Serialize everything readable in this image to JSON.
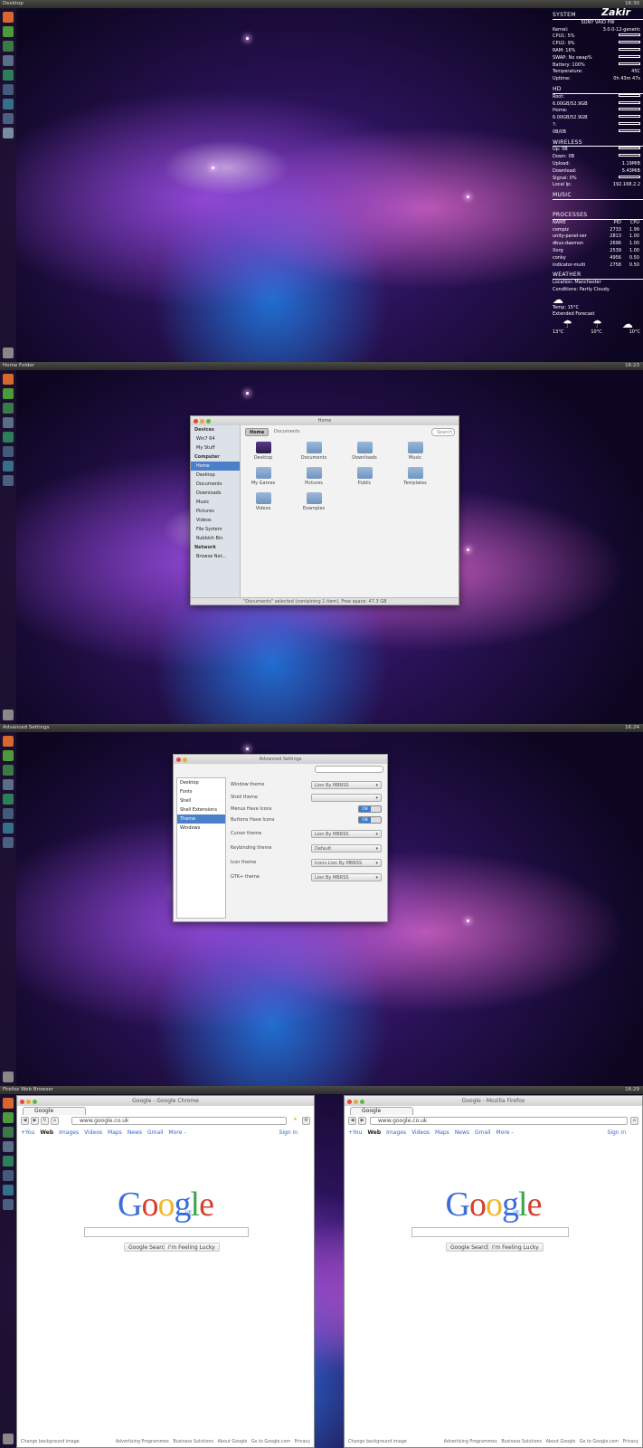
{
  "shots": [
    {
      "title": "Desktop",
      "time": "16:30"
    },
    {
      "title": "Home Folder",
      "time": "16:23"
    },
    {
      "title": "Advanced Settings",
      "time": "16:24"
    },
    {
      "title": "Firefox Web Browser",
      "time": "16:29"
    }
  ],
  "conky": {
    "system_label": "SYSTEM",
    "user": "Zakir",
    "machine": "SONY VAIO PW",
    "system_rows": [
      [
        "Kernel:",
        "3.0.0-12-generic"
      ],
      [
        "CPU1: 5%",
        ""
      ],
      [
        "CPU2: 9%",
        ""
      ],
      [
        "RAM: 16%",
        ""
      ],
      [
        "SWAP: No swap%",
        ""
      ],
      [
        "Battery: 100%",
        ""
      ],
      [
        "Temperature:",
        "45C"
      ],
      [
        "Uptime:",
        "0h 43m 47s"
      ]
    ],
    "hd_label": "HD",
    "hd_rows": [
      [
        "Root:",
        ""
      ],
      [
        "6.00GB/52.9GB",
        ""
      ],
      [
        "Home:",
        ""
      ],
      [
        "6.00GB/52.9GB",
        ""
      ],
      [
        "?:",
        ""
      ],
      [
        "0B/0B",
        ""
      ]
    ],
    "wireless_label": "WIRELESS",
    "wireless_rows": [
      [
        "Up: 0B",
        ""
      ],
      [
        "Down: 0B",
        ""
      ],
      [
        "Upload:",
        "1.19MiB"
      ],
      [
        "Download:",
        "5.43MiB"
      ],
      [
        "Signal: 0%",
        ""
      ],
      [
        "Local Ip:",
        "192.168.2.2"
      ]
    ],
    "music_label": "MUSIC",
    "processes_label": "PROCESSES",
    "proc_header": [
      "NAME",
      "PID",
      "CPU"
    ],
    "processes": [
      [
        "compiz",
        "2733",
        "1.99"
      ],
      [
        "unity-panel-ser",
        "2813",
        "1.00"
      ],
      [
        "dbus-daemon",
        "2696",
        "1.00"
      ],
      [
        "Xorg",
        "2539",
        "1.00"
      ],
      [
        "conky",
        "4956",
        "0.50"
      ],
      [
        "indicator-multi",
        "2758",
        "0.50"
      ]
    ],
    "weather_label": "WEATHER",
    "location": "Location: Manchester",
    "conditions": "Conditions: Partly Cloudy",
    "temp": "Temp: 15°C",
    "forecast": "Extended Forecast",
    "forecast_temps": [
      "13°C",
      "10°C",
      "10°C"
    ]
  },
  "nautilus": {
    "title": "Home",
    "devices_label": "Devices",
    "devices": [
      "Win7 64",
      "My Stuff"
    ],
    "computer_label": "Computer",
    "computer": [
      "Home",
      "Desktop",
      "Documents",
      "Downloads",
      "Music",
      "Pictures",
      "Videos",
      "File System",
      "Rubbish Bin"
    ],
    "network_label": "Network",
    "network": [
      "Browse Net..."
    ],
    "path_home": "Home",
    "path_docs": "Documents",
    "search": "Search",
    "files": [
      "Desktop",
      "Documents",
      "Downloads",
      "Music",
      "My Games",
      "Pictures",
      "Public",
      "Templates",
      "Videos",
      "Examples"
    ],
    "status": "\"Documents\" selected (containing 1 item), Free space: 47.3 GB"
  },
  "advsettings": {
    "title": "Advanced Settings",
    "nav": [
      "Desktop",
      "Fonts",
      "Shell",
      "Shell Extensions",
      "Theme",
      "Windows"
    ],
    "rows": [
      {
        "label": "Window theme",
        "value": "Lion By MBRSS"
      },
      {
        "label": "Shell theme",
        "value": ""
      },
      {
        "label": "Menus Have Icons",
        "value": "ON"
      },
      {
        "label": "Buttons Have Icons",
        "value": "ON"
      },
      {
        "label": "Cursor theme",
        "value": "Lion By MBRSS"
      },
      {
        "label": "Keybinding theme",
        "value": "Default"
      },
      {
        "label": "Icon theme",
        "value": "Icons Lion By MBRSS"
      },
      {
        "label": "GTK+ theme",
        "value": "Lion By MBRSS"
      }
    ]
  },
  "chrome": {
    "title": "Google - Google Chrome",
    "tab": "Google",
    "url": "www.google.co.uk",
    "links": [
      "+You",
      "Web",
      "Images",
      "Videos",
      "Maps",
      "News",
      "Gmail",
      "More -"
    ],
    "signin": "Sign in",
    "logo": "Google",
    "uk": "UK",
    "btn1": "Google Search",
    "btn2": "I'm Feeling Lucky",
    "footer_left": "Change background image",
    "footer_right": [
      "Advertising Programmes",
      "Business Solutions",
      "About Google",
      "Go to Google.com",
      "Privacy"
    ]
  },
  "firefox": {
    "title": "Google - Mozilla Firefox",
    "tab": "Google",
    "url": "www.google.co.uk",
    "links": [
      "+You",
      "Web",
      "Images",
      "Videos",
      "Maps",
      "News",
      "Gmail",
      "More -"
    ],
    "signin": "Sign in",
    "logo": "Google",
    "uk": "UK",
    "btn1": "Google Search",
    "btn2": "I'm Feeling Lucky",
    "footer_left": "Change background image",
    "footer_right": [
      "Advertising Programmes",
      "Business Solutions",
      "About Google",
      "Go to Google.com",
      "Privacy"
    ]
  }
}
